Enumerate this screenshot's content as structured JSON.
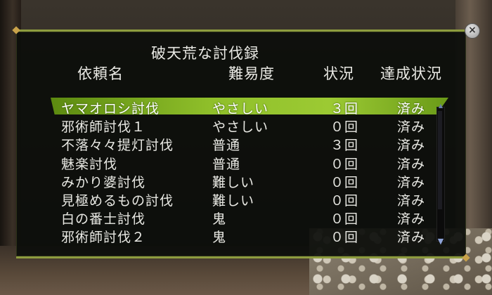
{
  "window": {
    "title": "破天荒な討伐録",
    "close_glyph": "×"
  },
  "headers": {
    "name": "依頼名",
    "difficulty": "難易度",
    "status": "状況",
    "completion": "達成状況"
  },
  "rows": [
    {
      "name": "ヤマオロシ討伐",
      "difficulty": "やさしい",
      "status": "３回",
      "completion": "済み",
      "selected": true
    },
    {
      "name": "邪術師討伐１",
      "difficulty": "やさしい",
      "status": "０回",
      "completion": "済み"
    },
    {
      "name": "不落々々提灯討伐",
      "difficulty": "普通",
      "status": "３回",
      "completion": "済み"
    },
    {
      "name": "魅楽討伐",
      "difficulty": "普通",
      "status": "０回",
      "completion": "済み"
    },
    {
      "name": "みかり婆討伐",
      "difficulty": "難しい",
      "status": "０回",
      "completion": "済み"
    },
    {
      "name": "見極めるもの討伐",
      "difficulty": "難しい",
      "status": "０回",
      "completion": "済み"
    },
    {
      "name": "白の番士討伐",
      "difficulty": "鬼",
      "status": "０回",
      "completion": "済み"
    },
    {
      "name": "邪術師討伐２",
      "difficulty": "鬼",
      "status": "０回",
      "completion": "済み"
    }
  ],
  "scroll": {
    "up_glyph": "▲",
    "down_glyph": "▼"
  },
  "colors": {
    "accent": "#8fbf2a",
    "text": "#e9e9e4",
    "border": "#8e9c3f"
  }
}
